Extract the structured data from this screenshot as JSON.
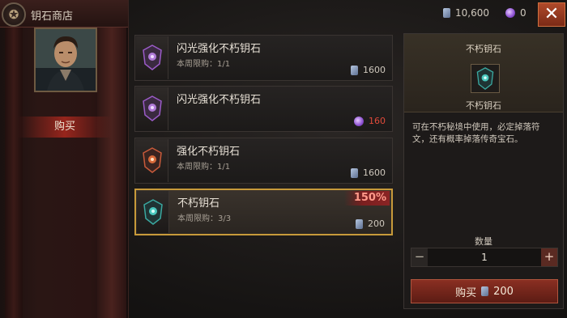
{
  "header": {
    "title": "钥石商店"
  },
  "sidebar": {
    "buy_tab": "购买"
  },
  "currency": {
    "gems": "10,600",
    "orbs": "0"
  },
  "items": [
    {
      "name": "闪光强化不朽钥石",
      "limit": "本周限购：1/1",
      "price": "1600",
      "price_currency": "gem",
      "badge": "",
      "accent": "#9b5bc8"
    },
    {
      "name": "闪光强化不朽钥石",
      "limit": "",
      "price": "160",
      "price_currency": "orb",
      "badge": "",
      "accent": "#9b5bc8"
    },
    {
      "name": "强化不朽钥石",
      "limit": "本周限购：1/1",
      "price": "1600",
      "price_currency": "gem",
      "badge": "",
      "accent": "#c85a3a"
    },
    {
      "name": "不朽钥石",
      "limit": "本周限购：3/3",
      "price": "200",
      "price_currency": "gem",
      "badge": "150%",
      "accent": "#3aa8a0"
    }
  ],
  "detail": {
    "title": "不朽钥石",
    "name": "不朽钥石",
    "description": "可在不朽秘境中使用，必定掉落符文，还有概率掉落传奇宝石。",
    "quantity_label": "数量",
    "quantity": "1",
    "buy_label": "购买",
    "buy_price": "200"
  }
}
